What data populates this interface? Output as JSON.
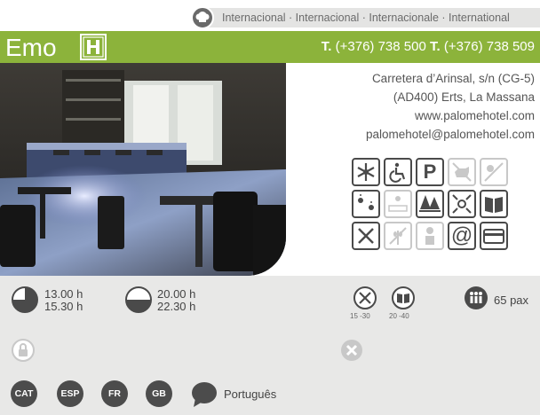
{
  "cuisine": {
    "text": "Internacional · Internacional · Internacionale · International"
  },
  "header": {
    "hotel_name": "Emo",
    "phone_prefix_1": "T.",
    "phone_1": "(+376) 738 500",
    "phone_prefix_2": "T.",
    "phone_2": "(+376) 738 509"
  },
  "address": {
    "line1": "Carretera d’Arinsal, s/n (CG-5)",
    "line2": "(AD400) Erts, La Massana",
    "web": "www.palomehotel.com",
    "email": "palomehotel@palomehotel.com"
  },
  "services": {
    "icons": [
      "snowflake-icon",
      "wheelchair-icon",
      "parking-icon",
      "no-pets-icon",
      "terrace-icon",
      "outdoor-icon",
      "sauna-icon",
      "forest-icon",
      "view-icon",
      "menu-book-icon",
      "cutlery-icon",
      "no-gluten-icon",
      "chef-icon",
      "at-icon",
      "credit-card-icon"
    ],
    "parking_label": "P",
    "at_label": "@"
  },
  "schedule": {
    "lunch_open": "13.00 h",
    "lunch_close": "15.30 h",
    "dinner_open": "20.00 h",
    "dinner_close": "22.30 h"
  },
  "prices": {
    "menu_range": "15 -30",
    "carte_range": "20 -40"
  },
  "capacity": {
    "label": "65 pax"
  },
  "languages": {
    "items": [
      "CAT",
      "ESP",
      "FR",
      "GB"
    ],
    "other": "Português"
  },
  "colors": {
    "accent": "#8cb33b",
    "icon_dark": "#4a4a4a",
    "panel": "#e8e8e7"
  }
}
